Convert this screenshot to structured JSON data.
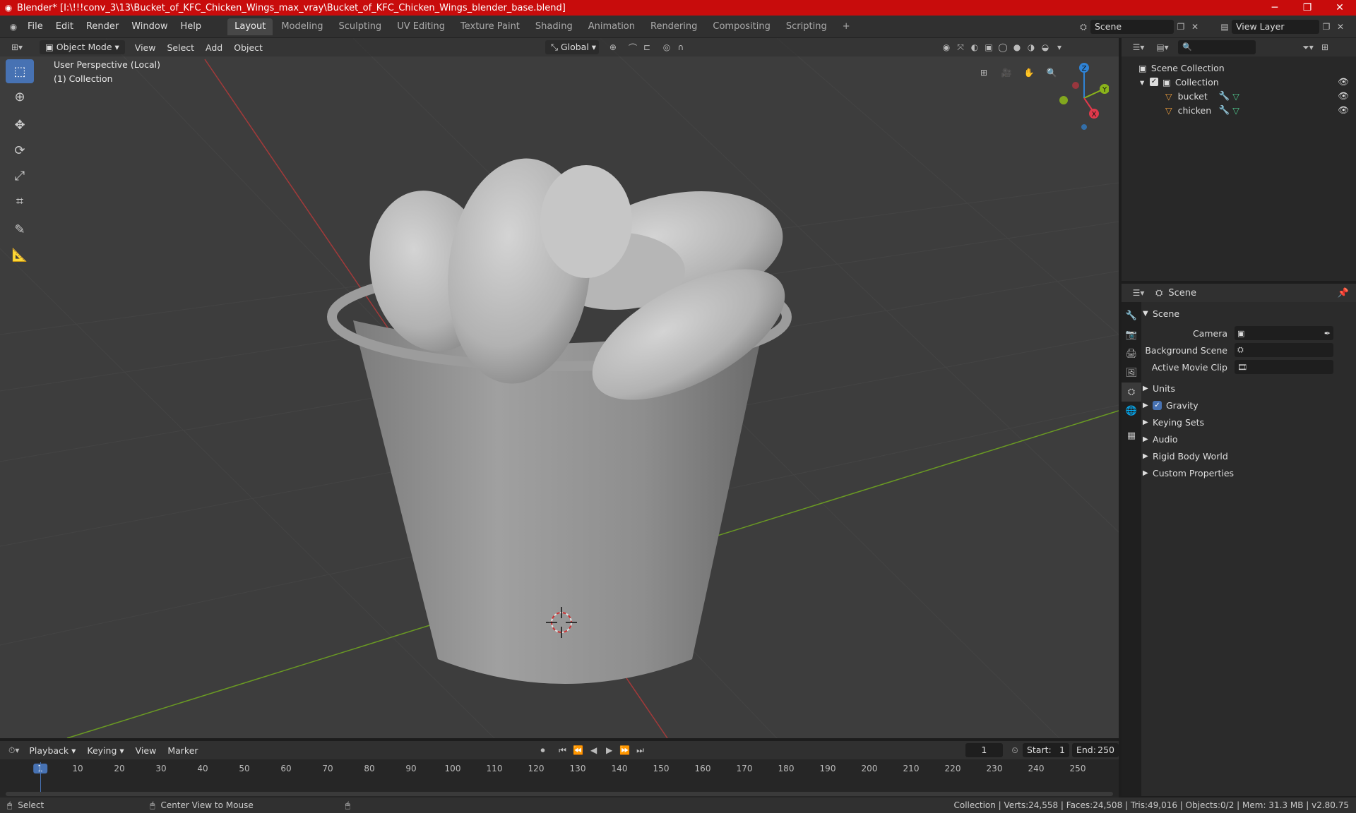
{
  "window": {
    "title": "Blender* [I:\\!!!conv_3\\13\\Bucket_of_KFC_Chicken_Wings_max_vray\\Bucket_of_KFC_Chicken_Wings_blender_base.blend]",
    "minimize": "─",
    "maximize": "❐",
    "close": "✕"
  },
  "menu": [
    "File",
    "Edit",
    "Render",
    "Window",
    "Help"
  ],
  "workspaces": [
    "Layout",
    "Modeling",
    "Sculpting",
    "UV Editing",
    "Texture Paint",
    "Shading",
    "Animation",
    "Rendering",
    "Compositing",
    "Scripting"
  ],
  "workspace_add": "+",
  "scene_selector": "Scene",
  "view_layer": "View Layer",
  "viewport": {
    "mode": "Object Mode",
    "menus": [
      "View",
      "Select",
      "Add",
      "Object"
    ],
    "orientation": "Global",
    "overlay_line1": "User Perspective (Local)",
    "overlay_line2": "(1) Collection",
    "gizmo": {
      "x": "X",
      "y": "Y",
      "z": "Z"
    }
  },
  "outliner": {
    "search_placeholder": "",
    "root": "Scene Collection",
    "collection": "Collection",
    "objects": [
      "bucket",
      "chicken"
    ]
  },
  "properties": {
    "context": "Scene",
    "panel": "Scene",
    "fields": [
      {
        "label": "Camera"
      },
      {
        "label": "Background Scene"
      },
      {
        "label": "Active Movie Clip"
      }
    ],
    "sections": [
      "Units",
      "Gravity",
      "Keying Sets",
      "Audio",
      "Rigid Body World",
      "Custom Properties"
    ]
  },
  "timeline": {
    "menus": [
      "Playback",
      "Keying",
      "View",
      "Marker"
    ],
    "current_frame": "1",
    "start_label": "Start:",
    "start": "1",
    "end_label": "End:",
    "end": "250",
    "ticks": [
      "1",
      "10",
      "20",
      "30",
      "40",
      "50",
      "60",
      "70",
      "80",
      "90",
      "100",
      "110",
      "120",
      "130",
      "140",
      "150",
      "160",
      "170",
      "180",
      "190",
      "200",
      "210",
      "220",
      "230",
      "240",
      "250"
    ]
  },
  "status": {
    "left1": "Select",
    "left2": "Center View to Mouse",
    "right": "Collection | Verts:24,558 | Faces:24,508 | Tris:49,016 | Objects:0/2 | Mem: 31.3 MB | v2.80.75"
  },
  "colors": {
    "titlebar": "#c80c0c",
    "accent": "#4772b3",
    "x_axis": "#a33a3a",
    "y_axis": "#6a9a23",
    "gizmo_x": "#e0394b",
    "gizmo_y": "#8ab31b",
    "gizmo_z": "#2f83d6"
  }
}
